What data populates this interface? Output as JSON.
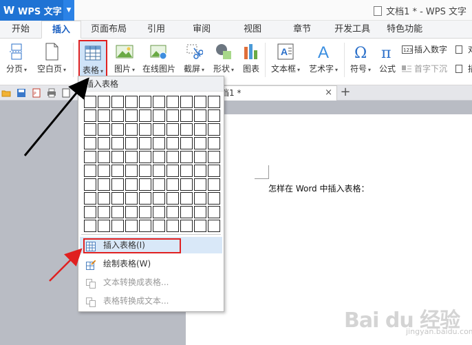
{
  "app": {
    "title": "WPS 文字",
    "document_title": "文档1 * - WPS 文字"
  },
  "tabs": [
    {
      "label": "开始"
    },
    {
      "label": "插入"
    },
    {
      "label": "页面布局"
    },
    {
      "label": "引用"
    },
    {
      "label": "审阅"
    },
    {
      "label": "视图"
    },
    {
      "label": "章节"
    },
    {
      "label": "开发工具"
    },
    {
      "label": "特色功能"
    }
  ],
  "ribbon": {
    "page_break": "分页",
    "blank_page": "空白页",
    "table": "表格",
    "picture": "图片",
    "online_picture": "在线图片",
    "screenshot": "截屏",
    "shapes": "形状",
    "chart": "图表",
    "textbox": "文本框",
    "wordart": "艺术字",
    "symbol": "符号",
    "formula": "公式",
    "insert_number": "插入数字",
    "drop_cap": "首字下沉",
    "object_partial": "对",
    "attach_partial": "插"
  },
  "doc_tab": {
    "label": "档1 *",
    "close": "×",
    "new": "+"
  },
  "dropdown": {
    "header": "插入表格",
    "items": [
      {
        "label": "插入表格(I)"
      },
      {
        "label": "绘制表格(W)"
      },
      {
        "label": "文本转换成表格..."
      },
      {
        "label": "表格转换成文本..."
      }
    ]
  },
  "document": {
    "text": "怎样在 Word 中插入表格："
  },
  "watermark": {
    "brand": "Bai du 经验",
    "sub": "jingyan.baidu.com"
  },
  "colors": {
    "accent": "#1f73d4",
    "highlight": "#e02020",
    "hover": "#d9e8f8"
  }
}
